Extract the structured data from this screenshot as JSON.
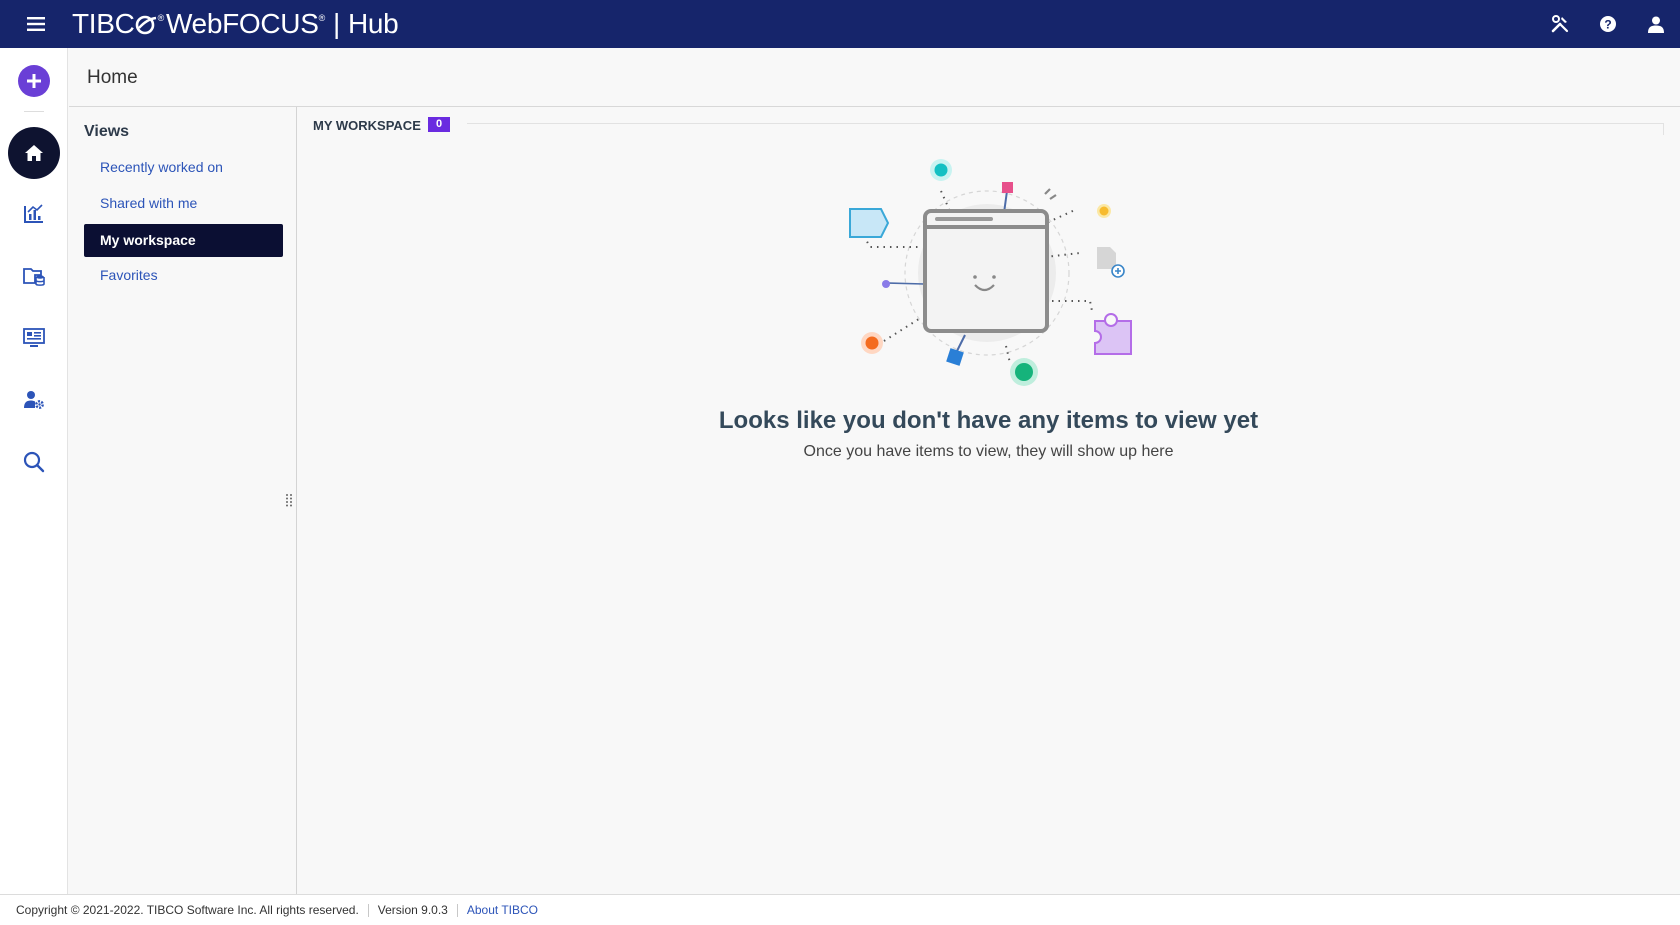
{
  "header": {
    "brand_main": "TIBC",
    "brand_product": "WebFOCUS",
    "brand_divider": "|",
    "brand_app": "Hub",
    "menu_icon": "hamburger-menu-icon",
    "actions": [
      {
        "icon": "tools-icon"
      },
      {
        "icon": "help-icon"
      },
      {
        "icon": "user-icon"
      }
    ]
  },
  "rail": {
    "add_icon": "plus-icon",
    "items": [
      {
        "icon": "home-icon",
        "active": true
      },
      {
        "icon": "chart-icon"
      },
      {
        "icon": "folder-database-icon"
      },
      {
        "icon": "dashboard-monitor-icon"
      },
      {
        "icon": "user-settings-icon"
      },
      {
        "icon": "search-icon"
      }
    ]
  },
  "page": {
    "title": "Home"
  },
  "views": {
    "title": "Views",
    "items": [
      {
        "label": "Recently worked on",
        "active": false
      },
      {
        "label": "Shared with me",
        "active": false
      },
      {
        "label": "My workspace",
        "active": true
      },
      {
        "label": "Favorites",
        "active": false
      }
    ]
  },
  "workspace": {
    "label": "MY WORKSPACE",
    "count": "0",
    "empty_title": "Looks like you don't have any items to view yet",
    "empty_subtitle": "Once you have items to view, they will show up here"
  },
  "footer": {
    "copyright": "Copyright © 2021-2022. TIBCO Software Inc. All rights reserved.",
    "version": "Version 9.0.3",
    "about": "About TIBCO"
  },
  "colors": {
    "topbar": "#16256b",
    "accent_purple": "#6a3fd6",
    "active_nav": "#0b0f33",
    "link_blue": "#2c54b8",
    "count_badge": "#6a2be0"
  }
}
